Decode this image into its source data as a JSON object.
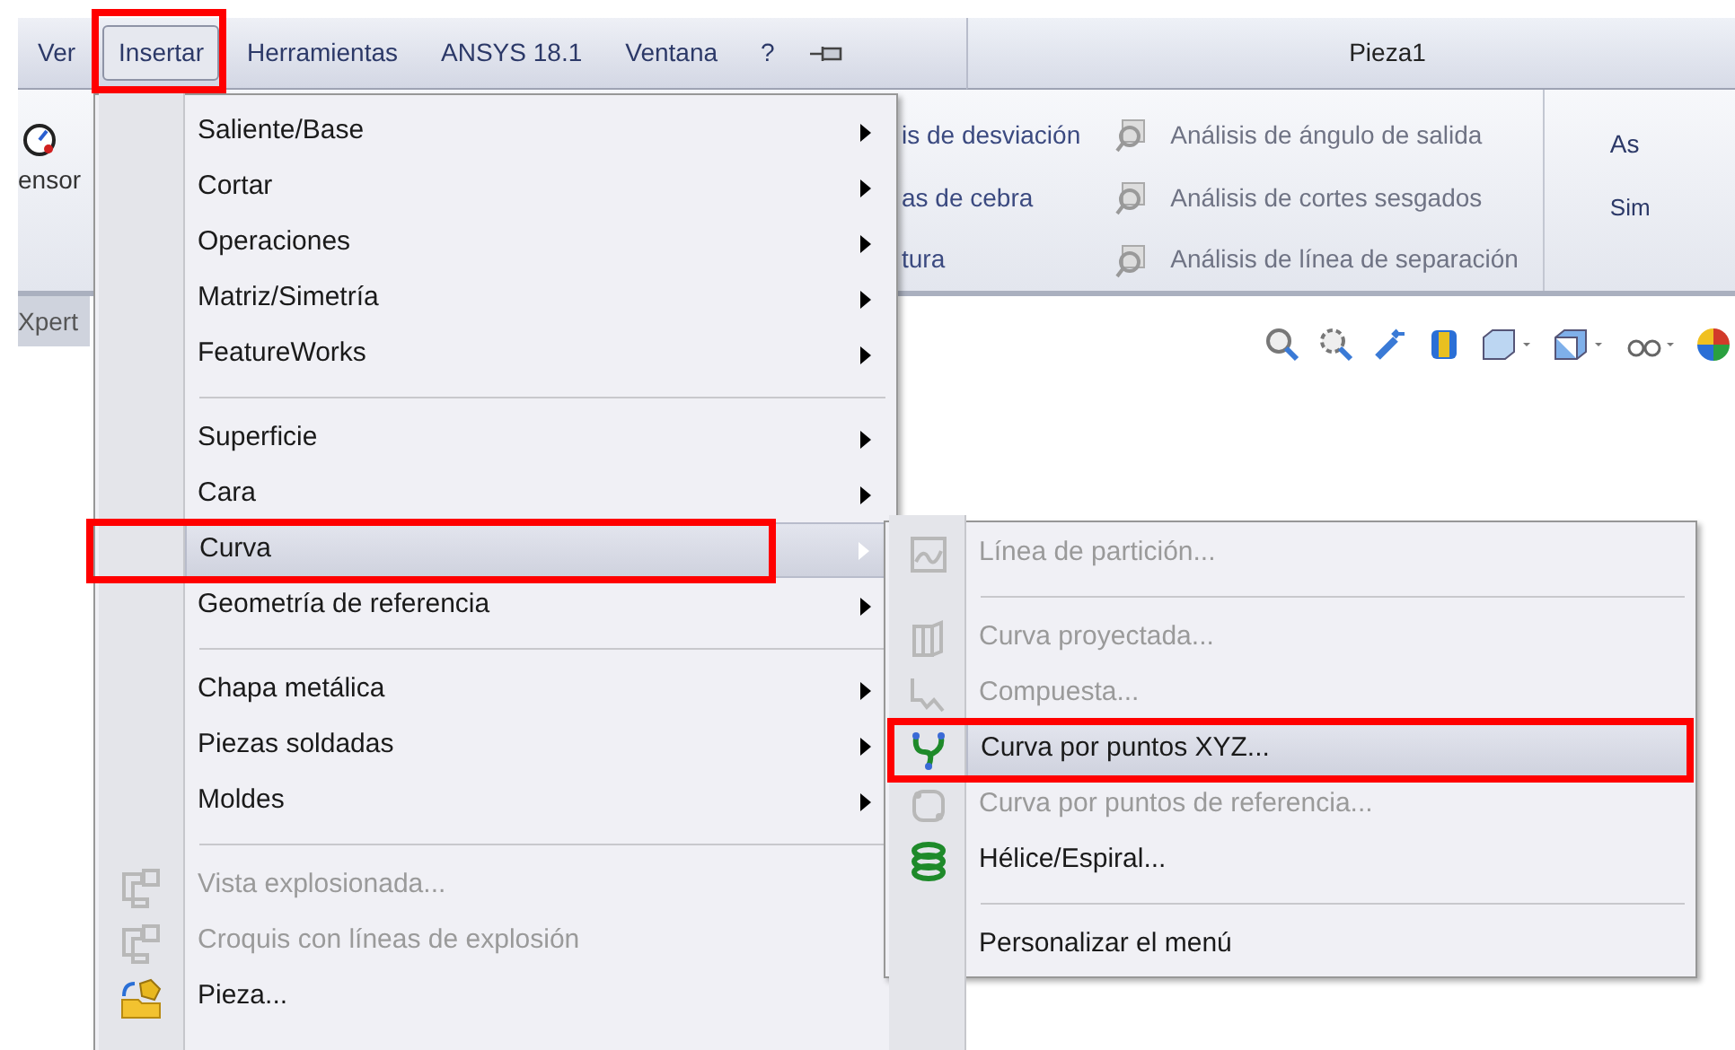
{
  "menu_bar": {
    "items": [
      {
        "label": "Ver",
        "selected": false,
        "annotated": false
      },
      {
        "label": "Insertar",
        "selected": true,
        "annotated": true
      },
      {
        "label": "Herramientas",
        "selected": false,
        "annotated": false
      },
      {
        "label": "ANSYS 18.1",
        "selected": false,
        "annotated": false
      },
      {
        "label": "Ventana",
        "selected": false,
        "annotated": false
      },
      {
        "label": "?",
        "selected": false,
        "annotated": false
      }
    ]
  },
  "window": {
    "title": "Pieza1"
  },
  "ribbon": {
    "left_button": {
      "label": "ensor"
    },
    "behind_items": [
      {
        "label": "is de desviación"
      },
      {
        "label": "as de cebra"
      },
      {
        "label": "tura"
      }
    ],
    "tools": [
      {
        "label": "Análisis de ángulo de salida"
      },
      {
        "label": "Análisis de cortes sesgados"
      },
      {
        "label": "Análisis de línea de separación"
      }
    ],
    "right_items": [
      {
        "label": "As"
      },
      {
        "label": "Sim"
      }
    ]
  },
  "side_tab": {
    "label": "Xpert"
  },
  "menu": {
    "items": [
      {
        "kind": "item",
        "label": "Saliente/Base",
        "has_submenu": true,
        "disabled": false,
        "selected": false,
        "annotated": false
      },
      {
        "kind": "item",
        "label": "Cortar",
        "has_submenu": true,
        "disabled": false,
        "selected": false,
        "annotated": false
      },
      {
        "kind": "item",
        "label": "Operaciones",
        "has_submenu": true,
        "disabled": false,
        "selected": false,
        "annotated": false
      },
      {
        "kind": "item",
        "label": "Matriz/Simetría",
        "has_submenu": true,
        "disabled": false,
        "selected": false,
        "annotated": false
      },
      {
        "kind": "item",
        "label": "FeatureWorks",
        "has_submenu": true,
        "disabled": false,
        "selected": false,
        "annotated": false
      },
      {
        "kind": "separator"
      },
      {
        "kind": "item",
        "label": "Superficie",
        "has_submenu": true,
        "disabled": false,
        "selected": false,
        "annotated": false
      },
      {
        "kind": "item",
        "label": "Cara",
        "has_submenu": true,
        "disabled": false,
        "selected": false,
        "annotated": false
      },
      {
        "kind": "item",
        "label": "Curva",
        "has_submenu": true,
        "disabled": false,
        "selected": true,
        "annotated": true
      },
      {
        "kind": "item",
        "label": "Geometría de referencia",
        "has_submenu": true,
        "disabled": false,
        "selected": false,
        "annotated": false
      },
      {
        "kind": "separator"
      },
      {
        "kind": "item",
        "label": "Chapa metálica",
        "has_submenu": true,
        "disabled": false,
        "selected": false,
        "annotated": false
      },
      {
        "kind": "item",
        "label": "Piezas soldadas",
        "has_submenu": true,
        "disabled": false,
        "selected": false,
        "annotated": false
      },
      {
        "kind": "item",
        "label": "Moldes",
        "has_submenu": true,
        "disabled": false,
        "selected": false,
        "annotated": false
      },
      {
        "kind": "separator"
      },
      {
        "kind": "item",
        "label": "Vista explosionada...",
        "has_submenu": false,
        "disabled": true,
        "selected": false,
        "annotated": false
      },
      {
        "kind": "item",
        "label": "Croquis con líneas de explosión",
        "has_submenu": false,
        "disabled": true,
        "selected": false,
        "annotated": false
      },
      {
        "kind": "item",
        "label": "Pieza...",
        "has_submenu": false,
        "disabled": false,
        "selected": false,
        "annotated": false
      }
    ]
  },
  "submenu": {
    "items": [
      {
        "kind": "item",
        "label": "Línea de partición...",
        "disabled": true,
        "selected": false,
        "annotated": false
      },
      {
        "kind": "separator"
      },
      {
        "kind": "item",
        "label": "Curva proyectada...",
        "disabled": true,
        "selected": false,
        "annotated": false
      },
      {
        "kind": "item",
        "label": "Compuesta...",
        "disabled": true,
        "selected": false,
        "annotated": false
      },
      {
        "kind": "item",
        "label": "Curva por puntos XYZ...",
        "disabled": false,
        "selected": true,
        "annotated": true
      },
      {
        "kind": "item",
        "label": "Curva por puntos de referencia...",
        "disabled": true,
        "selected": false,
        "annotated": false
      },
      {
        "kind": "item",
        "label": "Hélice/Espiral...",
        "disabled": false,
        "selected": false,
        "annotated": false
      },
      {
        "kind": "separator"
      },
      {
        "kind": "item",
        "label": "Personalizar el menú",
        "disabled": false,
        "selected": false,
        "annotated": false
      }
    ]
  }
}
